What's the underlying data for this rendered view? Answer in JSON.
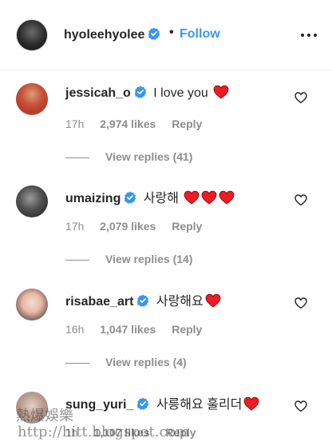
{
  "header": {
    "username": "hyoleehyolee",
    "separator": "•",
    "follow_label": "Follow"
  },
  "comments": [
    {
      "username": "jessicah_o",
      "text": "I love you",
      "hearts": 1,
      "time": "17h",
      "likes": "2,974 likes",
      "reply_label": "Reply",
      "view_replies": "View replies (41)"
    },
    {
      "username": "umaizing",
      "text": "사랑해",
      "hearts": 3,
      "time": "17h",
      "likes": "2,079 likes",
      "reply_label": "Reply",
      "view_replies": "View replies (14)"
    },
    {
      "username": "risabae_art",
      "text": "사랑해요",
      "hearts": 1,
      "time": "16h",
      "likes": "1,047 likes",
      "reply_label": "Reply",
      "view_replies": "View replies (4)"
    },
    {
      "username": "sung_yuri_",
      "text": "사릉해요 훌리더",
      "hearts": 1,
      "time": "1h",
      "likes": "1,107 likes",
      "reply_label": "Reply",
      "view_replies": ""
    }
  ],
  "watermark": {
    "line1": "熱爆娛樂",
    "line2": "http://hitt.blogspot.com"
  },
  "icons": {
    "verified": "verified-badge-icon",
    "more": "more-options-icon",
    "like": "heart-outline-icon",
    "emoji": "red-heart-emoji"
  },
  "colors": {
    "link": "#3897f0",
    "text": "#262626",
    "secondary": "#8e8e8e",
    "heart": "#ed1c24",
    "verified": "#3897f0"
  }
}
